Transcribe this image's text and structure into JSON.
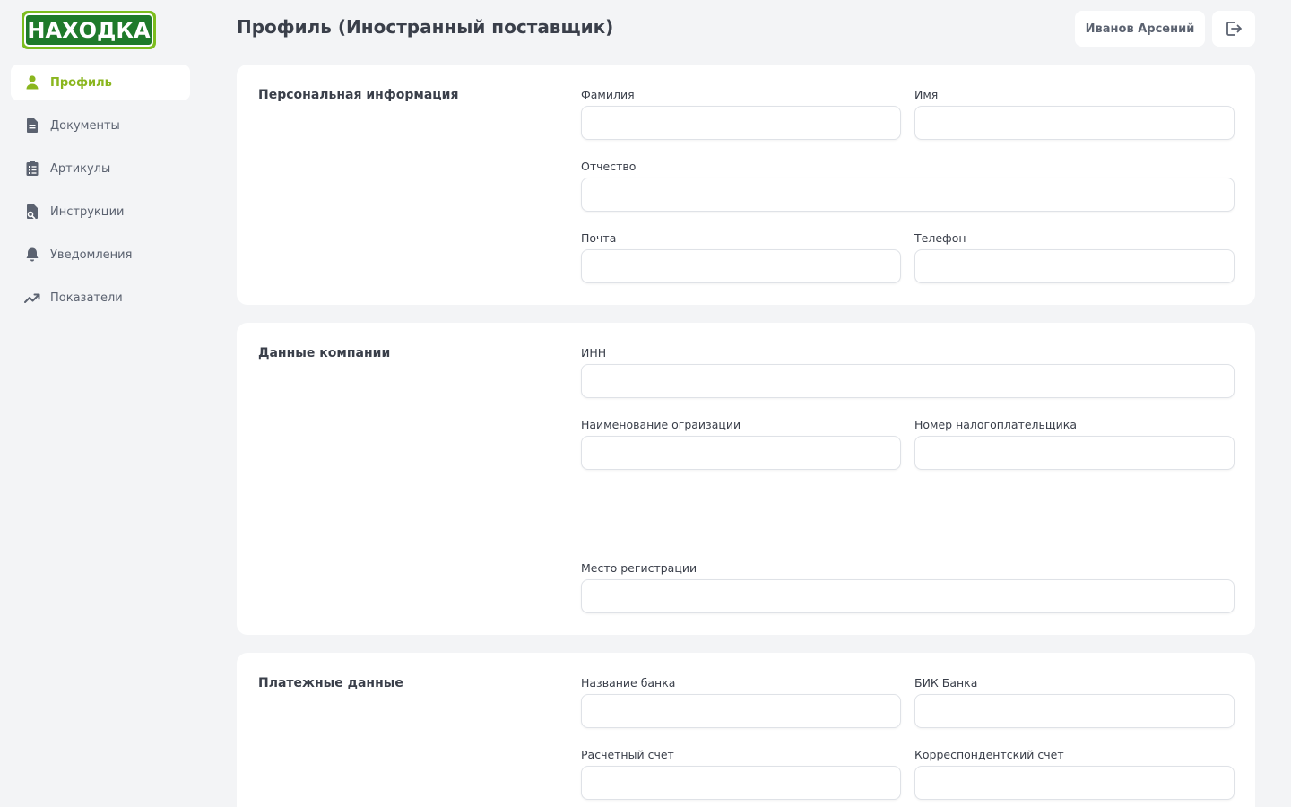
{
  "brand": {
    "logo_text": "НАХОДКА"
  },
  "sidebar": {
    "items": [
      {
        "label": "Профиль",
        "icon": "user-icon",
        "active": true
      },
      {
        "label": "Документы",
        "icon": "document-icon"
      },
      {
        "label": "Артикулы",
        "icon": "clipboard-list-icon"
      },
      {
        "label": "Инструкции",
        "icon": "instructions-icon"
      },
      {
        "label": "Уведомления",
        "icon": "bell-icon"
      },
      {
        "label": "Показатели",
        "icon": "trending-up-icon"
      }
    ]
  },
  "header": {
    "title": "Профиль (Иностранный поставщик)",
    "user_name": "Иванов Арсений",
    "logout_icon": "logout-icon"
  },
  "sections": {
    "personal": {
      "title": "Персональная информация",
      "last_name": {
        "label": "Фамилия",
        "value": ""
      },
      "first_name": {
        "label": "Имя",
        "value": ""
      },
      "patronymic": {
        "label": "Отчество",
        "value": ""
      },
      "email": {
        "label": "Почта",
        "value": ""
      },
      "phone": {
        "label": "Телефон",
        "value": ""
      }
    },
    "company": {
      "title": "Данные компании",
      "inn": {
        "label": "ИНН",
        "value": ""
      },
      "org_name": {
        "label": "Наименование ограизации",
        "value": ""
      },
      "taxpayer_number": {
        "label": "Номер налогоплательщика",
        "value": ""
      },
      "registration_place": {
        "label": "Место регистрации",
        "value": ""
      }
    },
    "payment": {
      "title": "Платежные данные",
      "bank_name": {
        "label": "Название банка",
        "value": ""
      },
      "bank_bik": {
        "label": "БИК Банка",
        "value": ""
      },
      "settlement_account": {
        "label": "Расчетный счет",
        "value": ""
      },
      "correspondent_account": {
        "label": "Корреспондентский счет",
        "value": ""
      }
    }
  },
  "colors": {
    "accent": "#8ab61e",
    "logo_green": "#1f7a2a",
    "logo_border": "#7cbd1e",
    "background": "#f3f4f6"
  }
}
